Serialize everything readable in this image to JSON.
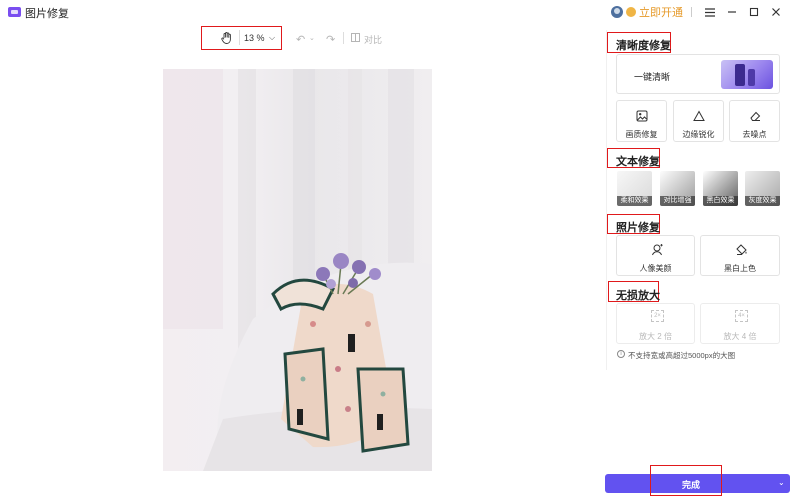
{
  "app": {
    "title": "图片修复"
  },
  "titlebar": {
    "vip_label": "立即开通"
  },
  "toolbar": {
    "zoom": "13 %",
    "compare_label": "对比"
  },
  "sections": {
    "clarity": {
      "title": "清晰度修复",
      "one_click": "一键清晰",
      "tools": [
        "画质修复",
        "边缘锐化",
        "去噪点"
      ]
    },
    "text": {
      "title": "文本修复",
      "effects": [
        "柔和效果",
        "对比增强",
        "黑白效果",
        "灰度效果"
      ]
    },
    "photo": {
      "title": "照片修复",
      "tools": [
        "人像美颜",
        "黑白上色"
      ]
    },
    "upscale": {
      "title": "无损放大",
      "tools": [
        {
          "label": "放大 2 倍",
          "icon_text": "2×"
        },
        {
          "label": "放大 4 倍",
          "icon_text": "4×"
        }
      ],
      "note": "不支持宽或高超过5000px的大图"
    }
  },
  "actions": {
    "done": "完成"
  },
  "colors": {
    "accent": "#6252f0",
    "highlight": "#e0191b",
    "vip": "#e69a2a"
  }
}
